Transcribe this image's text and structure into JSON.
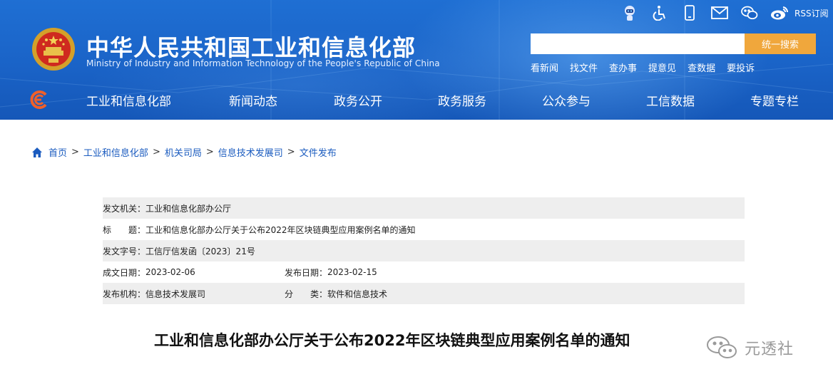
{
  "header": {
    "title": "中华人民共和国工业和信息化部",
    "subtitle": "Ministry of Industry and Information Technology of the People's Republic of China",
    "top_icons": [
      "robot-icon",
      "accessibility-icon",
      "mobile-icon",
      "mail-icon",
      "wechat-icon",
      "weibo-icon"
    ],
    "rss_label": "RSS订阅",
    "search": {
      "placeholder": "",
      "button_label": "统一搜索"
    },
    "quick_links": [
      "看新闻",
      "找文件",
      "查办事",
      "提意见",
      "查数据",
      "要投诉"
    ],
    "accent_color": "#f0a73c"
  },
  "nav": {
    "items": [
      "工业和信息化部",
      "新闻动态",
      "政务公开",
      "政务服务",
      "公众参与",
      "工信数据",
      "专题专栏"
    ]
  },
  "breadcrumb": [
    "首页",
    "工业和信息化部",
    "机关司局",
    "信息技术发展司",
    "文件发布"
  ],
  "info": {
    "issuer_label": "发文机关：",
    "issuer": "工业和信息化部办公厅",
    "title_label": "标　　题：",
    "title": "工业和信息化部办公厅关于公布2022年区块链典型应用案例名单的通知",
    "docno_label": "发文字号：",
    "docno": "工信厅信发函〔2023〕21号",
    "created_label": "成文日期：",
    "created": "2023-02-06",
    "published_label": "发布日期：",
    "published": "2023-02-15",
    "org_label": "发布机构：",
    "org": "信息技术发展司",
    "category_label": "分　　类：",
    "category": "软件和信息技术"
  },
  "article": {
    "title": "工业和信息化部办公厅关于公布2022年区块链典型应用案例名单的通知"
  },
  "watermark": {
    "text": "元透社"
  }
}
